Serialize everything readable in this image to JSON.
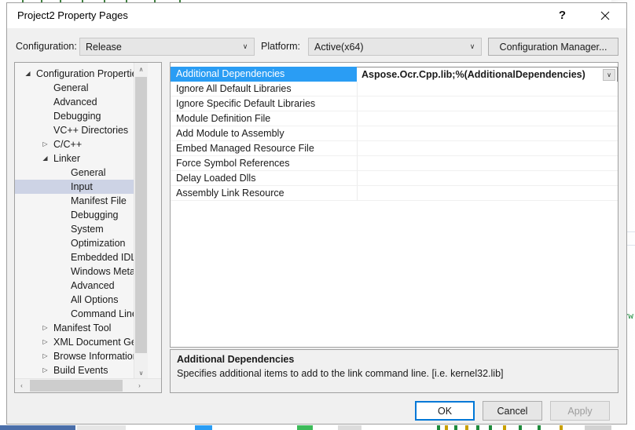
{
  "window": {
    "title": "Project2 Property Pages",
    "help_icon": "question-mark-icon",
    "help_label": "?",
    "close_label": "✕"
  },
  "config_bar": {
    "configuration_label": "Configuration:",
    "configuration_value": "Release",
    "platform_label": "Platform:",
    "platform_value": "Active(x64)",
    "configuration_manager_label": "Configuration Manager...",
    "dropdown_glyph": "∨"
  },
  "tree": {
    "items": [
      {
        "label": "Configuration Properties",
        "indent": 0,
        "twisty": "expanded",
        "selected": false
      },
      {
        "label": "General",
        "indent": 1,
        "twisty": "none",
        "selected": false
      },
      {
        "label": "Advanced",
        "indent": 1,
        "twisty": "none",
        "selected": false
      },
      {
        "label": "Debugging",
        "indent": 1,
        "twisty": "none",
        "selected": false
      },
      {
        "label": "VC++ Directories",
        "indent": 1,
        "twisty": "none",
        "selected": false
      },
      {
        "label": "C/C++",
        "indent": 1,
        "twisty": "collapsed",
        "selected": false
      },
      {
        "label": "Linker",
        "indent": 1,
        "twisty": "expanded",
        "selected": false
      },
      {
        "label": "General",
        "indent": 2,
        "twisty": "none",
        "selected": false
      },
      {
        "label": "Input",
        "indent": 2,
        "twisty": "none",
        "selected": true
      },
      {
        "label": "Manifest File",
        "indent": 2,
        "twisty": "none",
        "selected": false
      },
      {
        "label": "Debugging",
        "indent": 2,
        "twisty": "none",
        "selected": false
      },
      {
        "label": "System",
        "indent": 2,
        "twisty": "none",
        "selected": false
      },
      {
        "label": "Optimization",
        "indent": 2,
        "twisty": "none",
        "selected": false
      },
      {
        "label": "Embedded IDL",
        "indent": 2,
        "twisty": "none",
        "selected": false
      },
      {
        "label": "Windows Metadata",
        "indent": 2,
        "twisty": "none",
        "selected": false
      },
      {
        "label": "Advanced",
        "indent": 2,
        "twisty": "none",
        "selected": false
      },
      {
        "label": "All Options",
        "indent": 2,
        "twisty": "none",
        "selected": false
      },
      {
        "label": "Command Line",
        "indent": 2,
        "twisty": "none",
        "selected": false
      },
      {
        "label": "Manifest Tool",
        "indent": 1,
        "twisty": "collapsed",
        "selected": false
      },
      {
        "label": "XML Document Genera",
        "indent": 1,
        "twisty": "collapsed",
        "selected": false
      },
      {
        "label": "Browse Information",
        "indent": 1,
        "twisty": "collapsed",
        "selected": false
      },
      {
        "label": "Build Events",
        "indent": 1,
        "twisty": "collapsed",
        "selected": false
      }
    ],
    "twisty_expanded": "◢",
    "twisty_collapsed": "▷",
    "scroll_up_glyph": "∧",
    "scroll_down_glyph": "∨",
    "scroll_left_glyph": "‹",
    "scroll_right_glyph": "›"
  },
  "grid": {
    "rows": [
      {
        "name": "Additional Dependencies",
        "value": "Aspose.Ocr.Cpp.lib;%(AdditionalDependencies)",
        "selected": true,
        "has_dropdown": true
      },
      {
        "name": "Ignore All Default Libraries",
        "value": "",
        "selected": false,
        "has_dropdown": false
      },
      {
        "name": "Ignore Specific Default Libraries",
        "value": "",
        "selected": false,
        "has_dropdown": false
      },
      {
        "name": "Module Definition File",
        "value": "",
        "selected": false,
        "has_dropdown": false
      },
      {
        "name": "Add Module to Assembly",
        "value": "",
        "selected": false,
        "has_dropdown": false
      },
      {
        "name": "Embed Managed Resource File",
        "value": "",
        "selected": false,
        "has_dropdown": false
      },
      {
        "name": "Force Symbol References",
        "value": "",
        "selected": false,
        "has_dropdown": false
      },
      {
        "name": "Delay Loaded Dlls",
        "value": "",
        "selected": false,
        "has_dropdown": false
      },
      {
        "name": "Assembly Link Resource",
        "value": "",
        "selected": false,
        "has_dropdown": false
      }
    ],
    "dropdown_glyph": "∨",
    "selection_color": "#2a9df4"
  },
  "description": {
    "title": "Additional Dependencies",
    "body": "Specifies additional items to add to the link command line. [i.e. kernel32.lib]"
  },
  "footer": {
    "ok_label": "OK",
    "cancel_label": "Cancel",
    "apply_label": "Apply",
    "apply_enabled": false
  },
  "background": {
    "code_fragment": "uvw"
  }
}
